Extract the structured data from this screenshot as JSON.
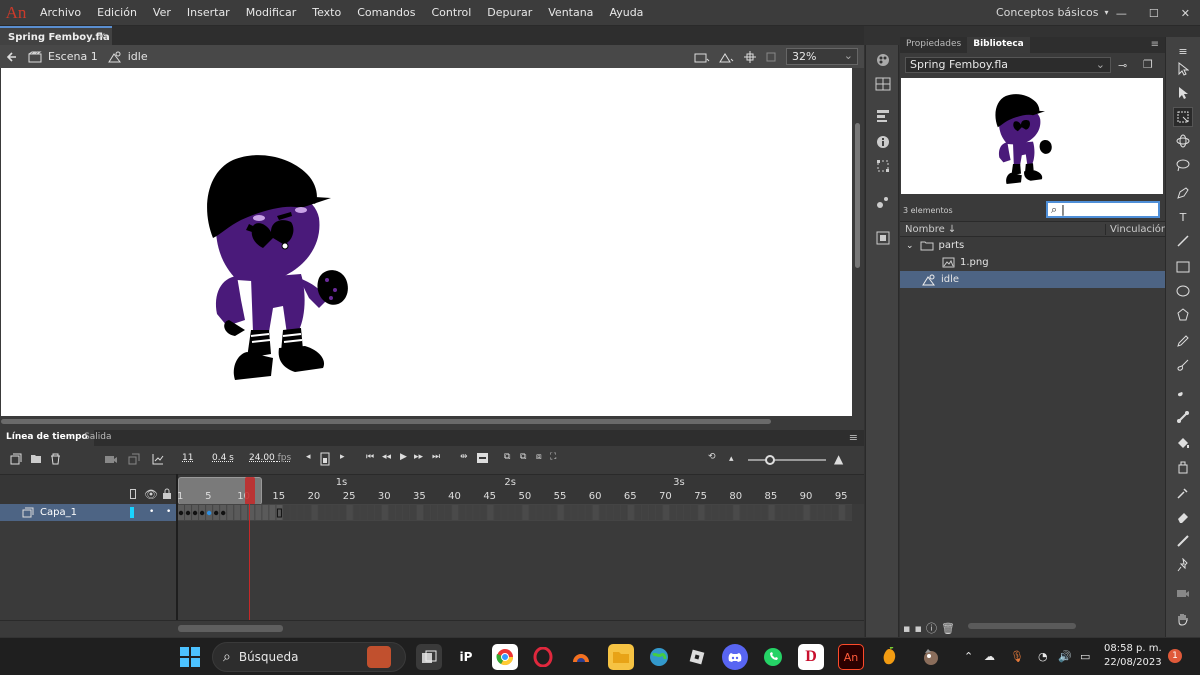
{
  "menu": {
    "logo": "An",
    "items": [
      "Archivo",
      "Edición",
      "Ver",
      "Insertar",
      "Modificar",
      "Texto",
      "Comandos",
      "Control",
      "Depurar",
      "Ventana",
      "Ayuda"
    ],
    "workspace": "Conceptos básicos"
  },
  "document": {
    "tab_title": "Spring Femboy.fla",
    "tab_close": "×"
  },
  "editbar": {
    "scene": "Escena 1",
    "symbol": "idle",
    "zoom": "32%"
  },
  "right_panel": {
    "tabs": [
      "Propiedades",
      "Biblioteca"
    ],
    "library_name": "Spring Femboy.fla",
    "count": "3 elementos",
    "search_placeholder": "",
    "col_name": "Nombre",
    "col_link": "Vinculación",
    "items": [
      {
        "label": "parts",
        "icon": "folder-icon"
      },
      {
        "label": "1.png",
        "icon": "bitmap-icon"
      },
      {
        "label": "idle",
        "icon": "movieclip-icon"
      }
    ]
  },
  "timeline": {
    "tabs": [
      "Línea de tiempo",
      "Salida"
    ],
    "current_frame": "11",
    "time": "0.4 s",
    "fps": "24.00",
    "fps_unit": "fps",
    "ruler_numbers": [
      "1",
      "5",
      "10",
      "15",
      "20",
      "25",
      "30",
      "35",
      "40",
      "45",
      "50",
      "55",
      "60",
      "65",
      "70",
      "75",
      "80",
      "85",
      "90",
      "95"
    ],
    "ruler_seconds": [
      "1s",
      "2s",
      "3s"
    ],
    "layer_name": "Capa_1"
  },
  "taskbar": {
    "search_label": "Búsqueda",
    "time": "08:58 p. m.",
    "date": "22/08/2023",
    "notifications": "1"
  },
  "colors": {
    "accent": "#4f8fd8",
    "selection": "#4d6484",
    "playhead": "#c62828",
    "character_purple": "#4a1a7a",
    "logo_red": "#cc3a2a"
  }
}
